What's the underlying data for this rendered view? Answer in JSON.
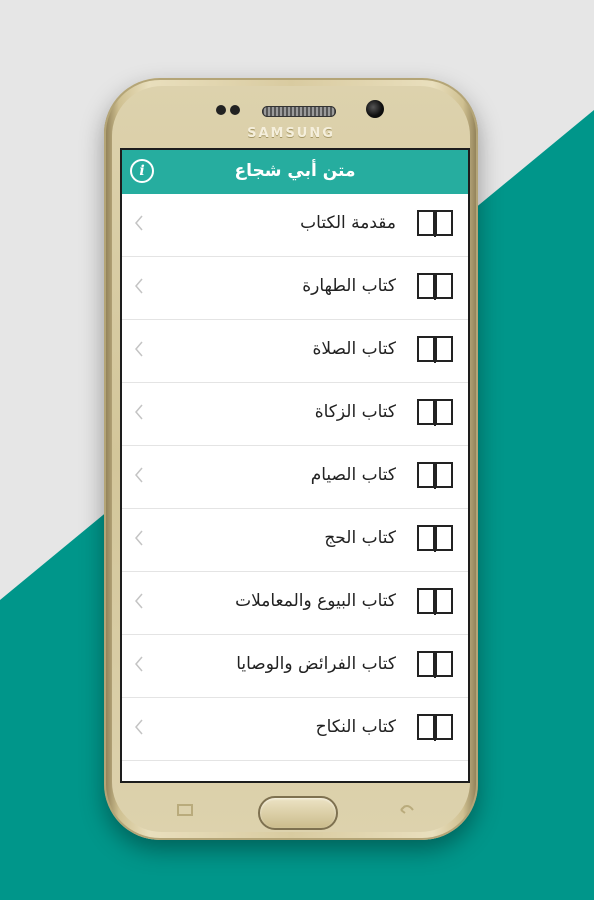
{
  "device": {
    "brand": "SAMSUNG"
  },
  "header": {
    "title": "متن أبي شجاع",
    "info_glyph": "i",
    "color": "#26ad9f"
  },
  "background": {
    "accent": "#00968a",
    "base": "#e6e6e6"
  },
  "items": [
    {
      "label": "مقدمة الكتاب"
    },
    {
      "label": "كتاب الطهارة"
    },
    {
      "label": "كتاب الصلاة"
    },
    {
      "label": "كتاب الزكاة"
    },
    {
      "label": "كتاب الصيام"
    },
    {
      "label": "كتاب الحج"
    },
    {
      "label": "كتاب البيوع والمعاملات"
    },
    {
      "label": "كتاب الفرائض والوصايا"
    },
    {
      "label": "كتاب النكاح"
    }
  ],
  "icons": {
    "item_icon": "open-book-icon",
    "chevron": "chevron-left-icon",
    "info": "info-icon"
  }
}
